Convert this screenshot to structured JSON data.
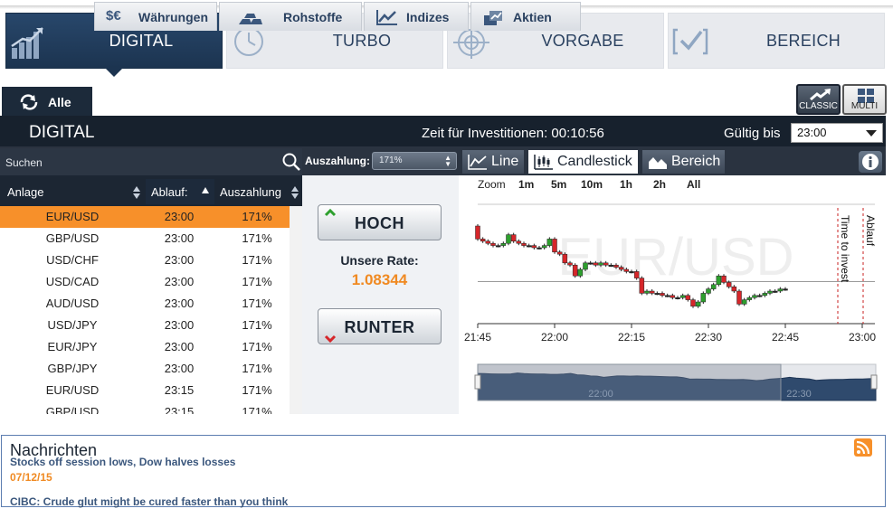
{
  "mode_tabs": [
    {
      "label": "DIGITAL",
      "icon": "bar-chart-icon",
      "active": true
    },
    {
      "label": "TURBO",
      "icon": "clock-icon",
      "active": false
    },
    {
      "label": "VORGABE",
      "icon": "target-icon",
      "active": false
    },
    {
      "label": "BEREICH",
      "icon": "range-check-icon",
      "active": false
    }
  ],
  "category_tabs": [
    {
      "label": "Alle",
      "icon": "refresh-icon"
    },
    {
      "label": "Währungen",
      "icon": "currency-icon"
    },
    {
      "label": "Rohstoffe",
      "icon": "gold-bars-icon"
    },
    {
      "label": "Indizes",
      "icon": "line-chart-icon"
    },
    {
      "label": "Aktien",
      "icon": "stock-icon"
    }
  ],
  "view_buttons": {
    "classic": "CLASSIC",
    "multi": "MULTI"
  },
  "header": {
    "title": "DIGITAL",
    "invest_time": "Zeit für Investitionen: 00:10:56",
    "valid_label": "Gültig bis",
    "valid_value": "23:00"
  },
  "search": {
    "placeholder": "Suchen"
  },
  "payout": {
    "label": "Auszahlung:",
    "value": "171%"
  },
  "chart_tabs": [
    {
      "label": "Line",
      "icon": "line-chart-icon"
    },
    {
      "label": "Candlestick",
      "icon": "candlestick-icon"
    },
    {
      "label": "Bereich",
      "icon": "area-chart-icon"
    }
  ],
  "table": {
    "columns": [
      "Anlage",
      "Ablauf:",
      "Auszahlung"
    ],
    "rows": [
      {
        "asset": "EUR/USD",
        "expiry": "23:00",
        "payout": "171%"
      },
      {
        "asset": "GBP/USD",
        "expiry": "23:00",
        "payout": "171%"
      },
      {
        "asset": "USD/CHF",
        "expiry": "23:00",
        "payout": "171%"
      },
      {
        "asset": "USD/CAD",
        "expiry": "23:00",
        "payout": "171%"
      },
      {
        "asset": "AUD/USD",
        "expiry": "23:00",
        "payout": "171%"
      },
      {
        "asset": "USD/JPY",
        "expiry": "23:00",
        "payout": "171%"
      },
      {
        "asset": "EUR/JPY",
        "expiry": "23:00",
        "payout": "171%"
      },
      {
        "asset": "GBP/JPY",
        "expiry": "23:00",
        "payout": "171%"
      },
      {
        "asset": "EUR/USD",
        "expiry": "23:15",
        "payout": "171%"
      },
      {
        "asset": "GBP/USD",
        "expiry": "23:15",
        "payout": "171%"
      }
    ]
  },
  "trade": {
    "call_label": "HOCH",
    "put_label": "RUNTER",
    "rate_label": "Unsere Rate:",
    "rate_value": "1.08344"
  },
  "chart": {
    "zoom_label": "Zoom",
    "zoom_options": [
      "1m",
      "5m",
      "10m",
      "1h",
      "2h",
      "All"
    ],
    "watermark": "EUR/USD",
    "x_ticks": [
      "21:45",
      "22:00",
      "22:15",
      "22:30",
      "22:45",
      "23:00"
    ],
    "markers": [
      "Time to invest",
      "Ablauf"
    ],
    "navigator_ticks": [
      "22:00",
      "22:30"
    ],
    "colors": {
      "up": "#2ea02e",
      "down": "#d6262a"
    }
  },
  "chart_data": {
    "type": "candlestick",
    "x": [
      "21:45",
      "21:46",
      "21:47",
      "21:48",
      "21:49",
      "21:50",
      "21:51",
      "21:52",
      "21:53",
      "21:54",
      "21:55",
      "21:56",
      "21:57",
      "21:58",
      "21:59",
      "22:00",
      "22:01",
      "22:02",
      "22:03",
      "22:04",
      "22:05",
      "22:06",
      "22:07",
      "22:08",
      "22:09",
      "22:10",
      "22:11",
      "22:12",
      "22:13",
      "22:14",
      "22:15",
      "22:16",
      "22:17",
      "22:18",
      "22:19",
      "22:20",
      "22:21",
      "22:22",
      "22:23",
      "22:24",
      "22:25",
      "22:26",
      "22:27",
      "22:28",
      "22:29",
      "22:30",
      "22:31",
      "22:32",
      "22:33",
      "22:34",
      "22:35",
      "22:36",
      "22:37",
      "22:38",
      "22:39",
      "22:40",
      "22:41",
      "22:42",
      "22:43",
      "22:44",
      "22:45"
    ],
    "open": [
      1.086,
      1.0854,
      1.0853,
      1.0852,
      1.0851,
      1.0851,
      1.0852,
      1.0856,
      1.0853,
      1.0852,
      1.0851,
      1.0851,
      1.085,
      1.085,
      1.0851,
      1.0854,
      1.0848,
      1.0847,
      1.0843,
      1.0842,
      1.0837,
      1.084,
      1.0843,
      1.0843,
      1.0842,
      1.0843,
      1.0842,
      1.0842,
      1.0841,
      1.084,
      1.0839,
      1.0839,
      1.0836,
      1.0829,
      1.083,
      1.0829,
      1.0829,
      1.0828,
      1.0828,
      1.0827,
      1.0827,
      1.0828,
      1.0826,
      1.0823,
      1.0825,
      1.0829,
      1.0831,
      1.0833,
      1.0837,
      1.0834,
      1.0832,
      1.083,
      1.0824,
      1.0826,
      1.0827,
      1.0828,
      1.0828,
      1.0829,
      1.083,
      1.083,
      1.0831
    ],
    "close": [
      1.0854,
      1.0853,
      1.0852,
      1.0851,
      1.0851,
      1.0852,
      1.0856,
      1.0853,
      1.0852,
      1.0851,
      1.0851,
      1.085,
      1.085,
      1.0851,
      1.0854,
      1.0848,
      1.0847,
      1.0843,
      1.0842,
      1.0837,
      1.084,
      1.0843,
      1.0843,
      1.0842,
      1.0843,
      1.0842,
      1.0842,
      1.0841,
      1.084,
      1.0839,
      1.0839,
      1.0836,
      1.0829,
      1.083,
      1.0829,
      1.0829,
      1.0828,
      1.0828,
      1.0827,
      1.0827,
      1.0828,
      1.0826,
      1.0823,
      1.0825,
      1.0829,
      1.0831,
      1.0833,
      1.0837,
      1.0834,
      1.0832,
      1.083,
      1.0824,
      1.0826,
      1.0827,
      1.0828,
      1.0828,
      1.0829,
      1.083,
      1.083,
      1.0831,
      1.0831
    ],
    "ylim": [
      1.0815,
      1.087
    ],
    "reference_rate": 1.08344
  },
  "news": {
    "title": "Nachrichten",
    "items": [
      {
        "headline": "Stocks off session lows, Dow halves losses",
        "date": "07/12/15"
      },
      {
        "headline": "CIBC: Crude glut might be cured faster than you think",
        "date": ""
      }
    ]
  }
}
